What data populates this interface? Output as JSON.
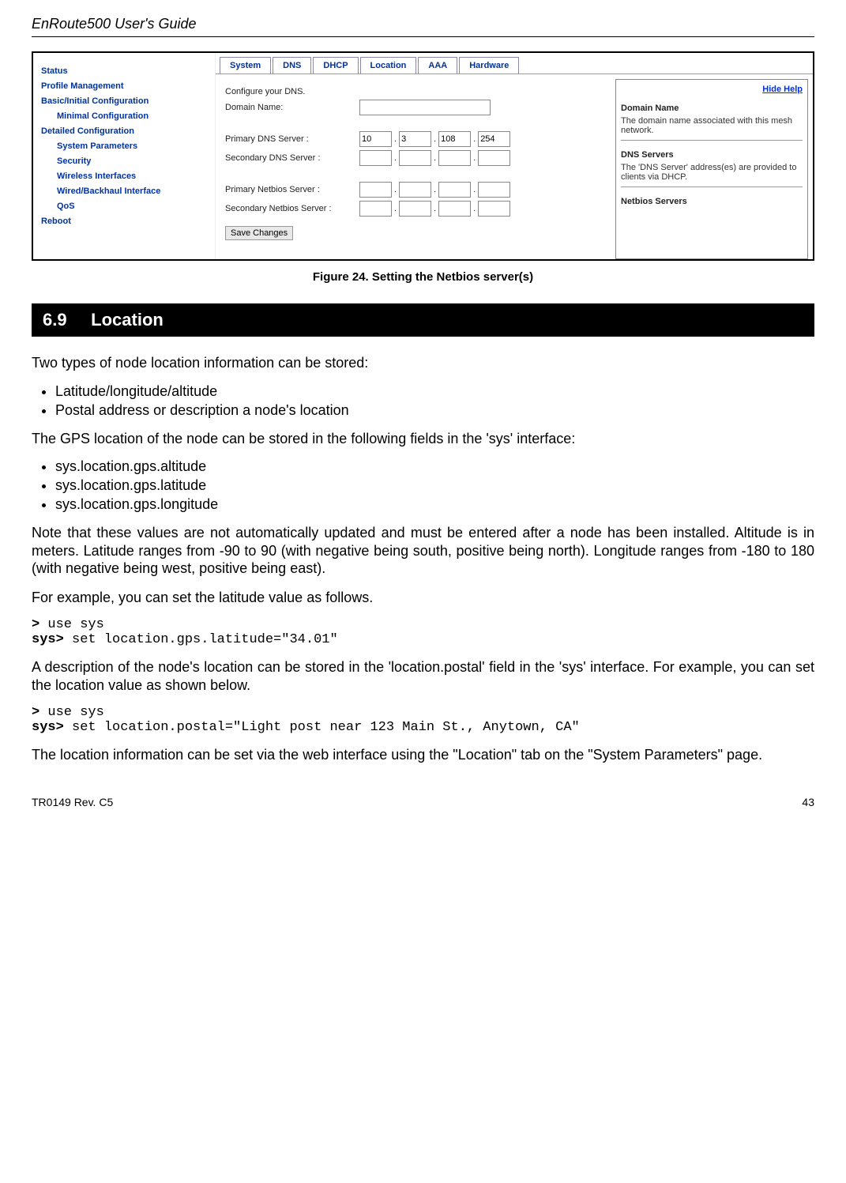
{
  "doc": {
    "header_title": "EnRoute500 User's Guide",
    "footer_left": "TR0149 Rev. C5",
    "footer_right": "43"
  },
  "screenshot": {
    "sidenav": {
      "status": "Status",
      "profile": "Profile Management",
      "basic": "Basic/Initial Configuration",
      "minimal": "Minimal Configuration",
      "detailed": "Detailed Configuration",
      "system_params": "System Parameters",
      "security": "Security",
      "wireless": "Wireless Interfaces",
      "wired": "Wired/Backhaul Interface",
      "qos": "QoS",
      "reboot": "Reboot"
    },
    "tabs": {
      "system": "System",
      "dns": "DNS",
      "dhcp": "DHCP",
      "location": "Location",
      "aaa": "AAA",
      "hardware": "Hardware"
    },
    "form": {
      "configure_label": "Configure your DNS.",
      "domain_name_label": "Domain Name:",
      "primary_dns_label": "Primary DNS Server :",
      "secondary_dns_label": "Secondary DNS Server :",
      "primary_netbios_label": "Primary Netbios Server :",
      "secondary_netbios_label": "Secondary Netbios Server :",
      "primary_dns": {
        "a": "10",
        "b": "3",
        "c": "108",
        "d": "254"
      },
      "save_button": "Save Changes"
    },
    "help": {
      "hide_link": "Hide Help",
      "h1": "Domain Name",
      "t1": "The domain name associated with this mesh network.",
      "h2": "DNS Servers",
      "t2": "The 'DNS Server' address(es) are provided to clients via DHCP.",
      "h3": "Netbios Servers"
    }
  },
  "figure": {
    "caption": "Figure 24. Setting the Netbios server(s)"
  },
  "section": {
    "number": "6.9",
    "title": "Location"
  },
  "body": {
    "p1": "Two types of node location information can be stored:",
    "list1": {
      "i1": "Latitude/longitude/altitude",
      "i2": "Postal address or description a node's location"
    },
    "p2": "The GPS location of the node can be stored in the following fields in the 'sys' interface:",
    "list2": {
      "i1": "sys.location.gps.altitude",
      "i2": "sys.location.gps.latitude",
      "i3": "sys.location.gps.longitude"
    },
    "p3": "Note that these values are not automatically updated and must be entered after a node has been installed. Altitude is in meters. Latitude ranges from -90 to 90 (with negative being south, positive being north). Longitude ranges from -180 to 180 (with negative being west, positive being east).",
    "p4": "For example, you can set the latitude value as follows.",
    "cli1_prompt1": ">",
    "cli1_cmd1": " use sys",
    "cli1_prompt2": "sys>",
    "cli1_cmd2": " set location.gps.latitude=\"34.01\"",
    "p5": "A description of the node's location can be stored in the 'location.postal' field in the 'sys' interface. For example, you can set the location value as shown below.",
    "cli2_prompt1": ">",
    "cli2_cmd1": " use sys",
    "cli2_prompt2": "sys>",
    "cli2_cmd2": " set location.postal=\"Light post near 123 Main St., Anytown, CA\"",
    "p6": "The location information can be set via the web interface using the \"Location\" tab on the \"System Parameters\" page."
  }
}
